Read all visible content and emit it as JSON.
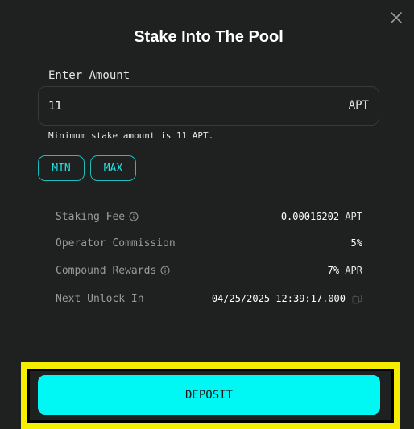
{
  "dialog": {
    "title": "Stake Into The Pool",
    "close_icon": "close-icon"
  },
  "amount": {
    "label": "Enter Amount",
    "value": "11",
    "unit": "APT",
    "note": "Minimum stake amount is 11 APT."
  },
  "quick": {
    "min_label": "MIN",
    "max_label": "MAX"
  },
  "details": {
    "staking_fee": {
      "label": "Staking Fee",
      "value": "0.00016202",
      "unit": "APT",
      "icon": "info-icon"
    },
    "operator_commission": {
      "label": "Operator Commission",
      "value": "5%"
    },
    "compound_rewards": {
      "label": "Compound Rewards",
      "value": "7%",
      "unit": "APR",
      "icon": "info-icon"
    },
    "next_unlock": {
      "label": "Next Unlock In",
      "value": "04/25/2025 12:39:17.000",
      "icon": "copy-icon"
    }
  },
  "deposit": {
    "label": "DEPOSIT"
  },
  "colors": {
    "background": "#1f2020",
    "accent": "#00f8f4",
    "pill_border": "#1fbcbc",
    "highlight": "#f6ee00"
  }
}
